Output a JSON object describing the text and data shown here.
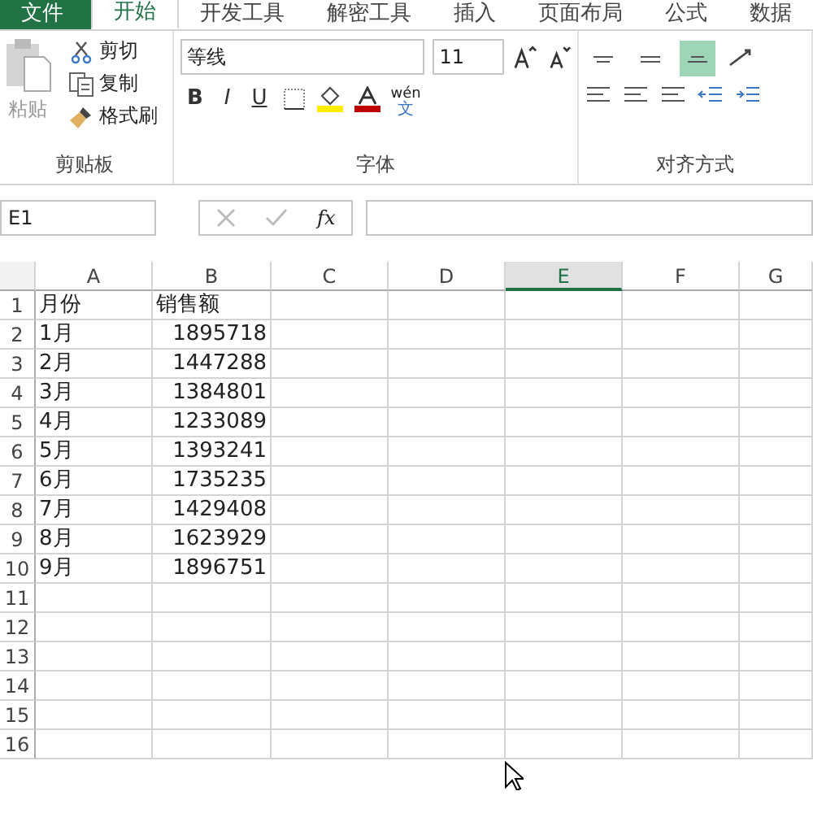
{
  "tabs": [
    {
      "label": "文件",
      "kind": "file",
      "selected": false
    },
    {
      "label": "开始",
      "kind": "tab",
      "selected": true
    },
    {
      "label": "开发工具",
      "kind": "tab",
      "selected": false
    },
    {
      "label": "解密工具",
      "kind": "tab",
      "selected": false
    },
    {
      "label": "插入",
      "kind": "tab",
      "selected": false
    },
    {
      "label": "页面布局",
      "kind": "tab",
      "selected": false
    },
    {
      "label": "公式",
      "kind": "tab",
      "selected": false
    },
    {
      "label": "数据",
      "kind": "tab",
      "selected": false
    }
  ],
  "clipboard": {
    "paste": "粘贴",
    "cut": "剪切",
    "copy": "复制",
    "format_painter": "格式刷",
    "group_label": "剪贴板"
  },
  "font": {
    "name": "等线",
    "size": "11",
    "bold": "B",
    "italic": "I",
    "underline": "U",
    "phonetic": "wén",
    "phonetic_char": "文",
    "group_label": "字体"
  },
  "alignment": {
    "group_label": "对齐方式",
    "vertical": [
      {
        "kind": "top",
        "selected": false
      },
      {
        "kind": "middle",
        "selected": false
      },
      {
        "kind": "bottom",
        "selected": true
      }
    ]
  },
  "formula_bar": {
    "name_box": "E1",
    "fx": "fx"
  },
  "sheet": {
    "columns": [
      {
        "label": "A",
        "selected": false
      },
      {
        "label": "B",
        "selected": false
      },
      {
        "label": "C",
        "selected": false
      },
      {
        "label": "D",
        "selected": false
      },
      {
        "label": "E",
        "selected": true
      },
      {
        "label": "F",
        "selected": false
      },
      {
        "label": "G",
        "selected": false
      }
    ],
    "header_row": {
      "num": "1",
      "a": "月份",
      "b": "销售额"
    },
    "rows": [
      {
        "num": "2",
        "a": "1月",
        "b": "1895718"
      },
      {
        "num": "3",
        "a": "2月",
        "b": "1447288"
      },
      {
        "num": "4",
        "a": "3月",
        "b": "1384801"
      },
      {
        "num": "5",
        "a": "4月",
        "b": "1233089"
      },
      {
        "num": "6",
        "a": "5月",
        "b": "1393241"
      },
      {
        "num": "7",
        "a": "6月",
        "b": "1735235"
      },
      {
        "num": "8",
        "a": "7月",
        "b": "1429408"
      },
      {
        "num": "9",
        "a": "8月",
        "b": "1623929"
      },
      {
        "num": "10",
        "a": "9月",
        "b": "1896751"
      },
      {
        "num": "11"
      },
      {
        "num": "12"
      },
      {
        "num": "13"
      },
      {
        "num": "14"
      },
      {
        "num": "15"
      },
      {
        "num": "16"
      }
    ]
  }
}
